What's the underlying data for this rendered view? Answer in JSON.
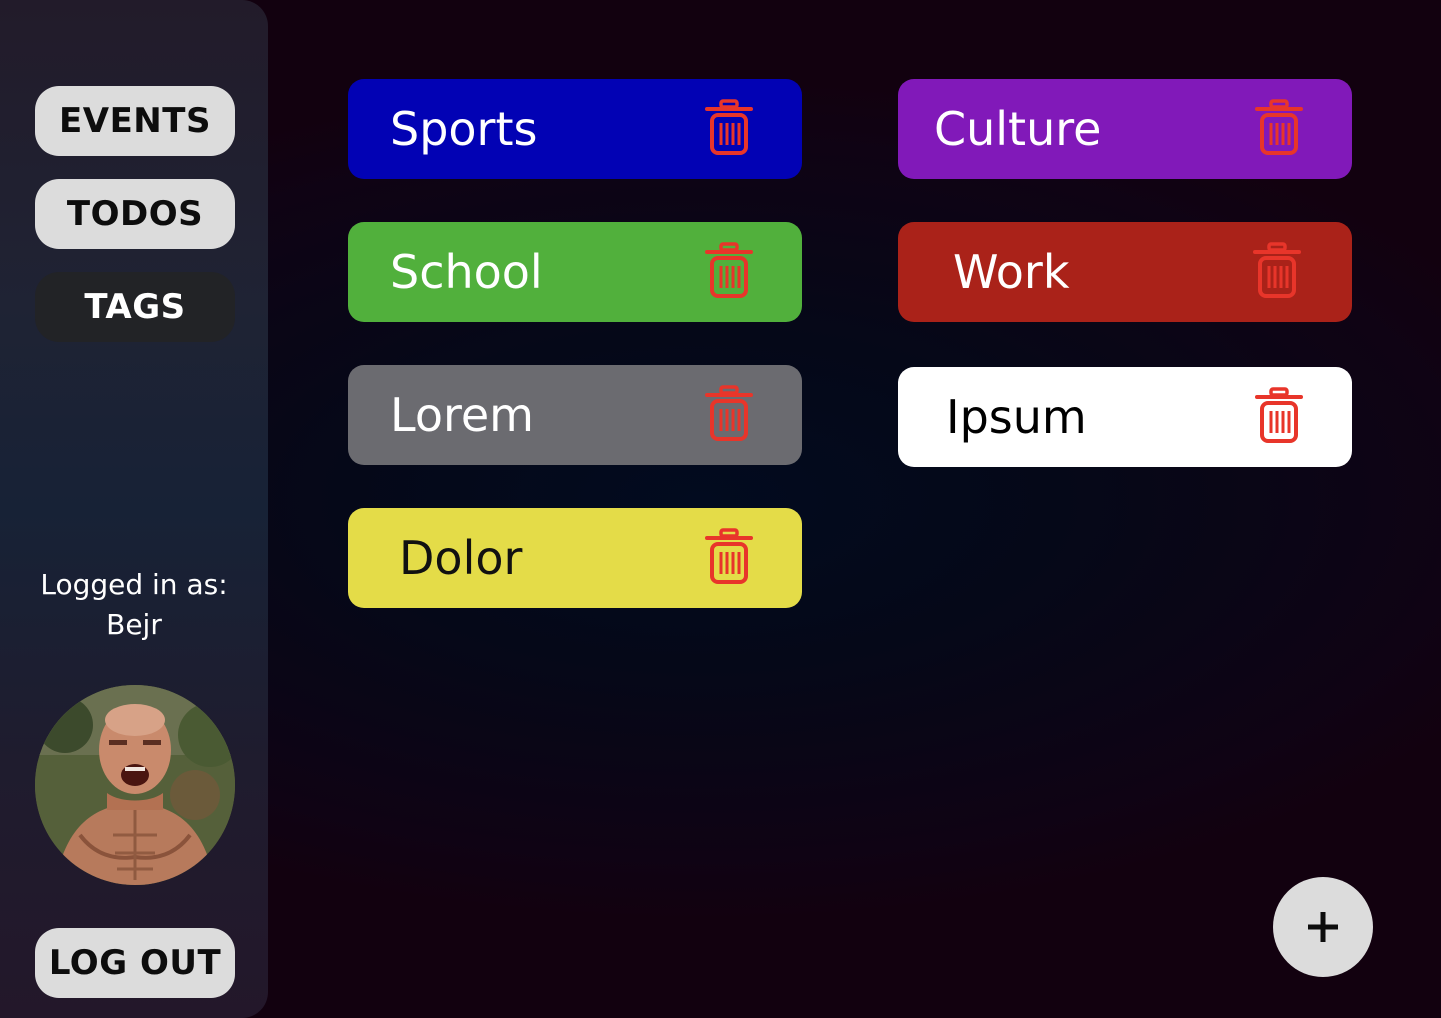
{
  "sidebar": {
    "nav": [
      {
        "label": "EVENTS",
        "active": false
      },
      {
        "label": "TODOS",
        "active": false
      },
      {
        "label": "TAGS",
        "active": true
      }
    ],
    "logged_in_label": "Logged in as:",
    "username": "Bejr",
    "logout_label": "LOG OUT"
  },
  "tags": [
    {
      "label": "Sports",
      "color": "#0202b4",
      "text_color": "#ffffff"
    },
    {
      "label": "Culture",
      "color": "#8119b9",
      "text_color": "#ffffff"
    },
    {
      "label": "School",
      "color": "#51b03c",
      "text_color": "#ffffff"
    },
    {
      "label": "Work",
      "color": "#aa2219",
      "text_color": "#ffffff"
    },
    {
      "label": "Lorem",
      "color": "#6b6b70",
      "text_color": "#ffffff"
    },
    {
      "label": "Ipsum",
      "color": "#ffffff",
      "text_color": "#000000"
    },
    {
      "label": "Dolor",
      "color": "#e4dc48",
      "text_color": "#111111"
    }
  ],
  "icons": {
    "delete": "trash-icon",
    "add": "plus-icon"
  },
  "colors": {
    "trash": "#e8352a",
    "button_bg": "#dcdcdc",
    "active_nav_bg": "#222326"
  },
  "fab_symbol": "+"
}
